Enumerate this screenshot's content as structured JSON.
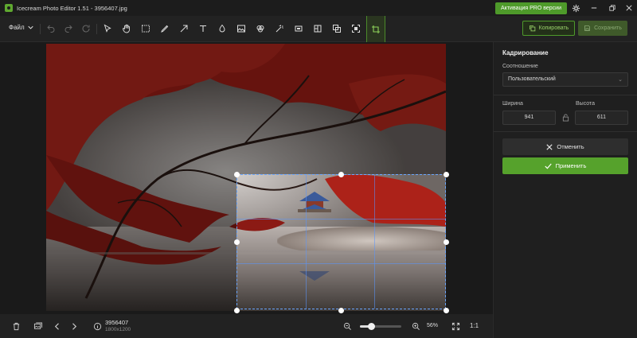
{
  "titlebar": {
    "app_title": "Icecream Photo Editor 1.51 - 3956407.jpg",
    "pro_button": "Активация PRO версии"
  },
  "toolbar": {
    "file_menu": "Файл",
    "copy_label": "Копировать",
    "save_label": "Сохранить",
    "active_tool": "crop"
  },
  "panel": {
    "title": "Кадрирование",
    "ratio_label": "Соотношение",
    "ratio_value": "Пользовательский",
    "width_label": "Ширина",
    "height_label": "Высота",
    "width_value": "941",
    "height_value": "611",
    "cancel_label": "Отменить",
    "apply_label": "Применить"
  },
  "status": {
    "file_name": "3956407",
    "file_dims": "1800x1200",
    "zoom_percent": "56%",
    "zoom_fraction": 0.28,
    "ratio_button": "1:1"
  },
  "colors": {
    "accent": "#56a22c",
    "crop_guide": "#6aa6ff",
    "foliage": "#b3241c"
  }
}
